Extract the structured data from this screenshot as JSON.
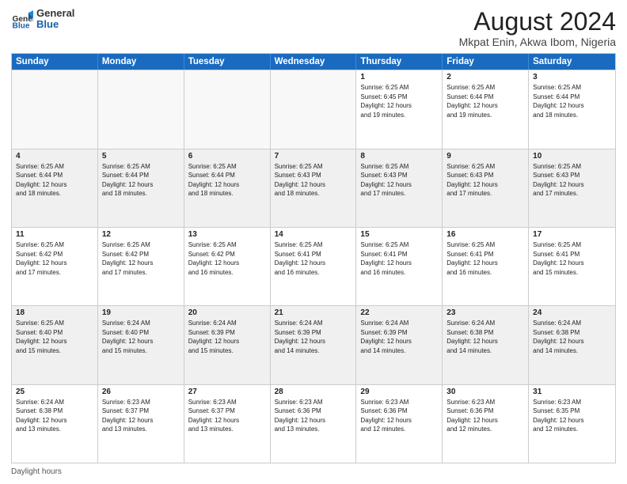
{
  "logo": {
    "general": "General",
    "blue": "Blue"
  },
  "title": "August 2024",
  "subtitle": "Mkpat Enin, Akwa Ibom, Nigeria",
  "header_days": [
    "Sunday",
    "Monday",
    "Tuesday",
    "Wednesday",
    "Thursday",
    "Friday",
    "Saturday"
  ],
  "footer": "Daylight hours",
  "weeks": [
    [
      {
        "day": "",
        "info": "",
        "empty": true
      },
      {
        "day": "",
        "info": "",
        "empty": true
      },
      {
        "day": "",
        "info": "",
        "empty": true
      },
      {
        "day": "",
        "info": "",
        "empty": true
      },
      {
        "day": "1",
        "info": "Sunrise: 6:25 AM\nSunset: 6:45 PM\nDaylight: 12 hours\nand 19 minutes."
      },
      {
        "day": "2",
        "info": "Sunrise: 6:25 AM\nSunset: 6:44 PM\nDaylight: 12 hours\nand 19 minutes."
      },
      {
        "day": "3",
        "info": "Sunrise: 6:25 AM\nSunset: 6:44 PM\nDaylight: 12 hours\nand 18 minutes."
      }
    ],
    [
      {
        "day": "4",
        "info": "Sunrise: 6:25 AM\nSunset: 6:44 PM\nDaylight: 12 hours\nand 18 minutes."
      },
      {
        "day": "5",
        "info": "Sunrise: 6:25 AM\nSunset: 6:44 PM\nDaylight: 12 hours\nand 18 minutes."
      },
      {
        "day": "6",
        "info": "Sunrise: 6:25 AM\nSunset: 6:44 PM\nDaylight: 12 hours\nand 18 minutes."
      },
      {
        "day": "7",
        "info": "Sunrise: 6:25 AM\nSunset: 6:43 PM\nDaylight: 12 hours\nand 18 minutes."
      },
      {
        "day": "8",
        "info": "Sunrise: 6:25 AM\nSunset: 6:43 PM\nDaylight: 12 hours\nand 17 minutes."
      },
      {
        "day": "9",
        "info": "Sunrise: 6:25 AM\nSunset: 6:43 PM\nDaylight: 12 hours\nand 17 minutes."
      },
      {
        "day": "10",
        "info": "Sunrise: 6:25 AM\nSunset: 6:43 PM\nDaylight: 12 hours\nand 17 minutes."
      }
    ],
    [
      {
        "day": "11",
        "info": "Sunrise: 6:25 AM\nSunset: 6:42 PM\nDaylight: 12 hours\nand 17 minutes."
      },
      {
        "day": "12",
        "info": "Sunrise: 6:25 AM\nSunset: 6:42 PM\nDaylight: 12 hours\nand 17 minutes."
      },
      {
        "day": "13",
        "info": "Sunrise: 6:25 AM\nSunset: 6:42 PM\nDaylight: 12 hours\nand 16 minutes."
      },
      {
        "day": "14",
        "info": "Sunrise: 6:25 AM\nSunset: 6:41 PM\nDaylight: 12 hours\nand 16 minutes."
      },
      {
        "day": "15",
        "info": "Sunrise: 6:25 AM\nSunset: 6:41 PM\nDaylight: 12 hours\nand 16 minutes."
      },
      {
        "day": "16",
        "info": "Sunrise: 6:25 AM\nSunset: 6:41 PM\nDaylight: 12 hours\nand 16 minutes."
      },
      {
        "day": "17",
        "info": "Sunrise: 6:25 AM\nSunset: 6:41 PM\nDaylight: 12 hours\nand 15 minutes."
      }
    ],
    [
      {
        "day": "18",
        "info": "Sunrise: 6:25 AM\nSunset: 6:40 PM\nDaylight: 12 hours\nand 15 minutes."
      },
      {
        "day": "19",
        "info": "Sunrise: 6:24 AM\nSunset: 6:40 PM\nDaylight: 12 hours\nand 15 minutes."
      },
      {
        "day": "20",
        "info": "Sunrise: 6:24 AM\nSunset: 6:39 PM\nDaylight: 12 hours\nand 15 minutes."
      },
      {
        "day": "21",
        "info": "Sunrise: 6:24 AM\nSunset: 6:39 PM\nDaylight: 12 hours\nand 14 minutes."
      },
      {
        "day": "22",
        "info": "Sunrise: 6:24 AM\nSunset: 6:39 PM\nDaylight: 12 hours\nand 14 minutes."
      },
      {
        "day": "23",
        "info": "Sunrise: 6:24 AM\nSunset: 6:38 PM\nDaylight: 12 hours\nand 14 minutes."
      },
      {
        "day": "24",
        "info": "Sunrise: 6:24 AM\nSunset: 6:38 PM\nDaylight: 12 hours\nand 14 minutes."
      }
    ],
    [
      {
        "day": "25",
        "info": "Sunrise: 6:24 AM\nSunset: 6:38 PM\nDaylight: 12 hours\nand 13 minutes."
      },
      {
        "day": "26",
        "info": "Sunrise: 6:23 AM\nSunset: 6:37 PM\nDaylight: 12 hours\nand 13 minutes."
      },
      {
        "day": "27",
        "info": "Sunrise: 6:23 AM\nSunset: 6:37 PM\nDaylight: 12 hours\nand 13 minutes."
      },
      {
        "day": "28",
        "info": "Sunrise: 6:23 AM\nSunset: 6:36 PM\nDaylight: 12 hours\nand 13 minutes."
      },
      {
        "day": "29",
        "info": "Sunrise: 6:23 AM\nSunset: 6:36 PM\nDaylight: 12 hours\nand 12 minutes."
      },
      {
        "day": "30",
        "info": "Sunrise: 6:23 AM\nSunset: 6:36 PM\nDaylight: 12 hours\nand 12 minutes."
      },
      {
        "day": "31",
        "info": "Sunrise: 6:23 AM\nSunset: 6:35 PM\nDaylight: 12 hours\nand 12 minutes."
      }
    ]
  ]
}
